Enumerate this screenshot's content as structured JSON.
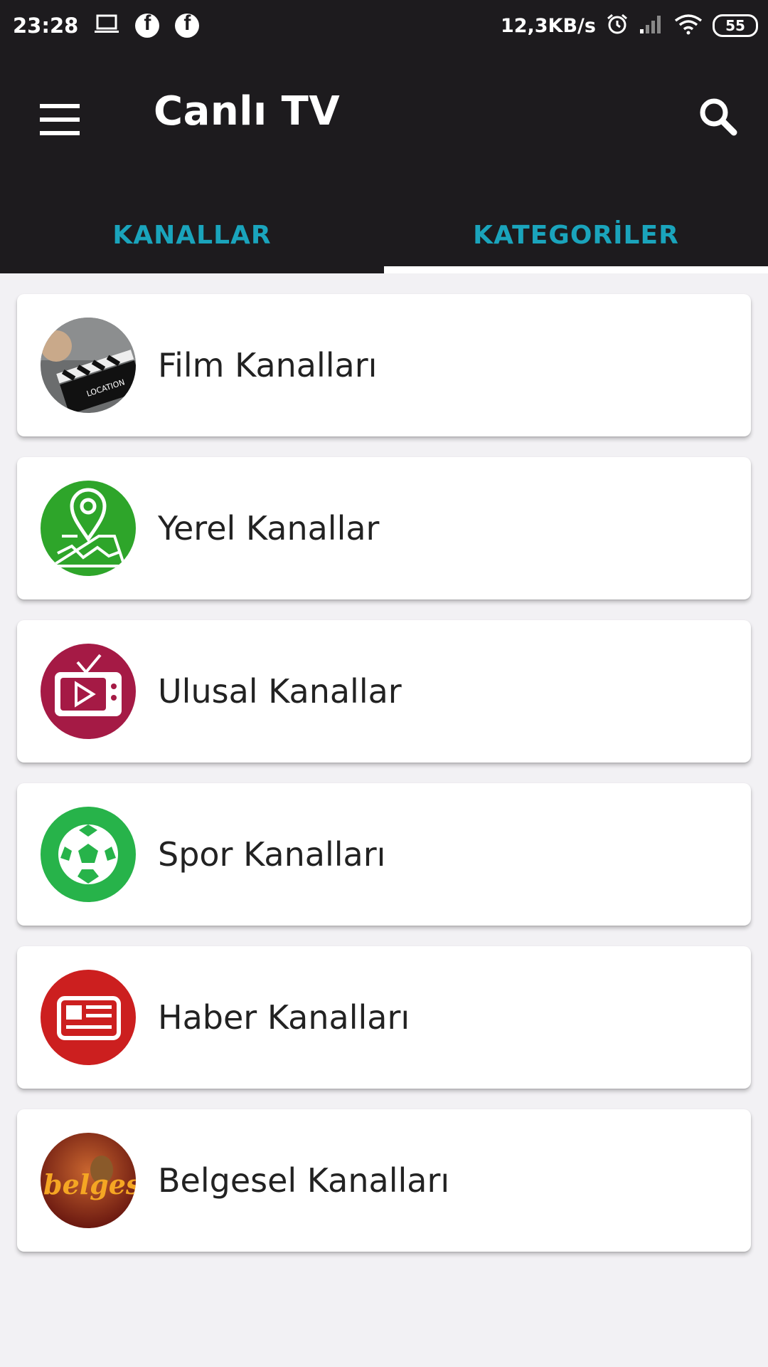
{
  "status_bar": {
    "time": "23:28",
    "network_speed": "12,3KB/s",
    "battery": "55",
    "icons": [
      "laptop-icon",
      "facebook-icon",
      "facebook-icon",
      "alarm-icon",
      "signal-icon",
      "wifi-icon",
      "battery-icon"
    ]
  },
  "app_bar": {
    "title": "Canlı TV",
    "menu_icon": "menu-icon",
    "search_icon": "search-icon"
  },
  "tabs": [
    {
      "label": "KANALLAR",
      "selected": false
    },
    {
      "label": "KATEGORİLER",
      "selected": true
    }
  ],
  "colors": {
    "bar_background": "#1d1b1e",
    "tab_text": "#1aa4bc",
    "page_background": "#f2f1f4"
  },
  "categories": [
    {
      "label": "Film Kanalları",
      "icon": "film-clapperboard-icon"
    },
    {
      "label": "Yerel Kanallar",
      "icon": "map-pin-icon"
    },
    {
      "label": "Ulusal Kanallar",
      "icon": "tv-play-icon"
    },
    {
      "label": "Spor Kanalları",
      "icon": "soccer-ball-icon"
    },
    {
      "label": "Haber Kanalları",
      "icon": "newspaper-icon"
    },
    {
      "label": "Belgesel Kanalları",
      "icon": "belgesel-logo-icon",
      "icon_text": "belgesel"
    }
  ]
}
